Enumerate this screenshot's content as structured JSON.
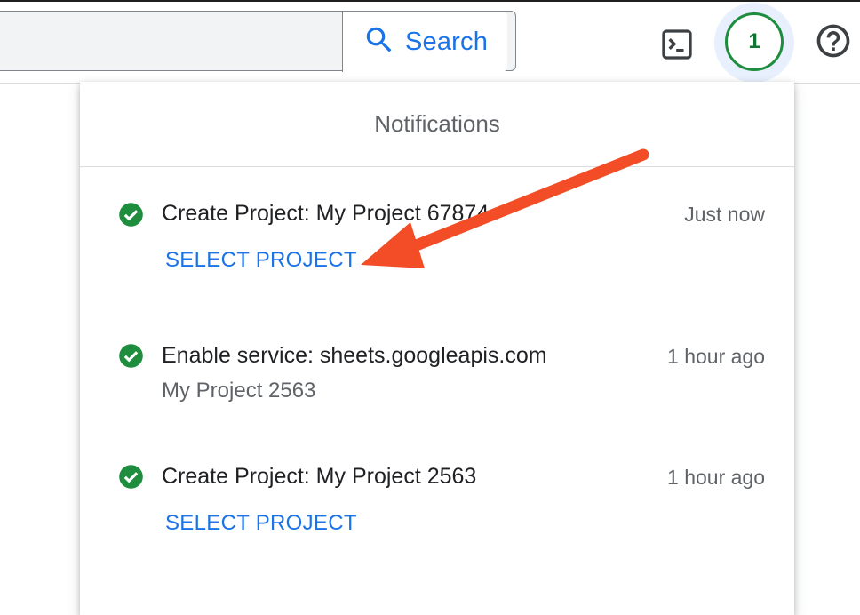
{
  "header": {
    "search_label": "Search",
    "notification_count": "1",
    "icons": {
      "search": "search-icon",
      "terminal": "cloud-shell-icon",
      "help": "help-icon"
    }
  },
  "panel": {
    "title": "Notifications",
    "items": [
      {
        "status_icon": "check-circle-icon",
        "title": "Create Project: My Project 67874",
        "time": "Just now",
        "action": "SELECT PROJECT"
      },
      {
        "status_icon": "check-circle-icon",
        "title": "Enable service: sheets.googleapis.com",
        "time": "1 hour ago",
        "subtitle": "My Project 2563"
      },
      {
        "status_icon": "check-circle-icon",
        "title": "Create Project: My Project 2563",
        "time": "1 hour ago",
        "action": "SELECT PROJECT"
      }
    ]
  },
  "colors": {
    "accent_blue": "#1a73e8",
    "success_green": "#1e8e3e",
    "annotation_arrow": "#f24d26"
  }
}
